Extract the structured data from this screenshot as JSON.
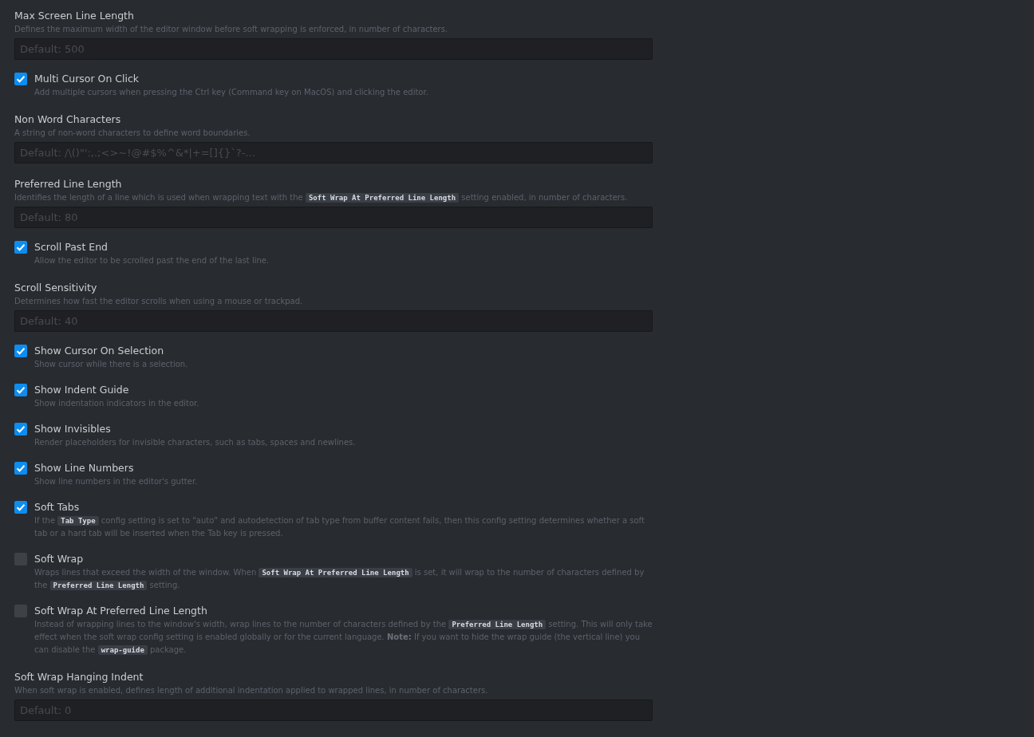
{
  "settings": [
    {
      "kind": "field",
      "title": "Max Screen Line Length",
      "description": [
        {
          "kind": "text",
          "text": "Defines the maximum width of the editor window before soft wrapping is enforced, in number of characters."
        }
      ],
      "placeholder": "Default: 500"
    },
    {
      "kind": "checkbox",
      "title": "Multi Cursor On Click",
      "checked": true,
      "description": [
        {
          "kind": "text",
          "text": "Add multiple cursors when pressing the Ctrl key (Command key on MacOS) and clicking the editor."
        }
      ]
    },
    {
      "kind": "field",
      "title": "Non Word Characters",
      "description": [
        {
          "kind": "text",
          "text": "A string of non-word characters to define word boundaries."
        }
      ],
      "placeholder": "Default: /\\()\"':,.;<>~!@#$%^&*|+=[]{}`?-…"
    },
    {
      "kind": "field",
      "title": "Preferred Line Length",
      "description": [
        {
          "kind": "text",
          "text": "Identifies the length of a line which is used when wrapping text with the "
        },
        {
          "kind": "code",
          "text": "Soft Wrap At Preferred Line Length"
        },
        {
          "kind": "text",
          "text": " setting enabled, in number of characters."
        }
      ],
      "placeholder": "Default: 80"
    },
    {
      "kind": "checkbox",
      "title": "Scroll Past End",
      "checked": true,
      "description": [
        {
          "kind": "text",
          "text": "Allow the editor to be scrolled past the end of the last line."
        }
      ]
    },
    {
      "kind": "field",
      "title": "Scroll Sensitivity",
      "description": [
        {
          "kind": "text",
          "text": "Determines how fast the editor scrolls when using a mouse or trackpad."
        }
      ],
      "placeholder": "Default: 40"
    },
    {
      "kind": "checkbox",
      "title": "Show Cursor On Selection",
      "checked": true,
      "description": [
        {
          "kind": "text",
          "text": "Show cursor while there is a selection."
        }
      ]
    },
    {
      "kind": "checkbox",
      "title": "Show Indent Guide",
      "checked": true,
      "description": [
        {
          "kind": "text",
          "text": "Show indentation indicators in the editor."
        }
      ]
    },
    {
      "kind": "checkbox",
      "title": "Show Invisibles",
      "checked": true,
      "description": [
        {
          "kind": "text",
          "text": "Render placeholders for invisible characters, such as tabs, spaces and newlines."
        }
      ]
    },
    {
      "kind": "checkbox",
      "title": "Show Line Numbers",
      "checked": true,
      "description": [
        {
          "kind": "text",
          "text": "Show line numbers in the editor's gutter."
        }
      ]
    },
    {
      "kind": "checkbox",
      "title": "Soft Tabs",
      "checked": true,
      "description": [
        {
          "kind": "text",
          "text": "If the "
        },
        {
          "kind": "code",
          "text": "Tab Type"
        },
        {
          "kind": "text",
          "text": " config setting is set to \"auto\" and autodetection of tab type from buffer content fails, then this config setting determines whether a soft tab or a hard tab will be inserted when the Tab key is pressed."
        }
      ]
    },
    {
      "kind": "checkbox",
      "title": "Soft Wrap",
      "checked": false,
      "description": [
        {
          "kind": "text",
          "text": "Wraps lines that exceed the width of the window. When "
        },
        {
          "kind": "code",
          "text": "Soft Wrap At Preferred Line Length"
        },
        {
          "kind": "text",
          "text": " is set, it will wrap to the number of characters defined by the "
        },
        {
          "kind": "code",
          "text": "Preferred Line Length"
        },
        {
          "kind": "text",
          "text": " setting."
        }
      ]
    },
    {
      "kind": "checkbox",
      "title": "Soft Wrap At Preferred Line Length",
      "checked": false,
      "description": [
        {
          "kind": "text",
          "text": "Instead of wrapping lines to the window's width, wrap lines to the number of characters defined by the "
        },
        {
          "kind": "code",
          "text": "Preferred Line Length"
        },
        {
          "kind": "text",
          "text": " setting. This will only take effect when the soft wrap config setting is enabled globally or for the current language. **Note:** If you want to hide the wrap guide (the vertical line) you can disable the "
        },
        {
          "kind": "code",
          "text": "wrap-guide"
        },
        {
          "kind": "text",
          "text": " package."
        }
      ]
    },
    {
      "kind": "field",
      "title": "Soft Wrap Hanging Indent",
      "description": [
        {
          "kind": "text",
          "text": "When soft wrap is enabled, defines length of additional indentation applied to wrapped lines, in number of characters."
        }
      ],
      "placeholder": "Default: 0"
    }
  ]
}
